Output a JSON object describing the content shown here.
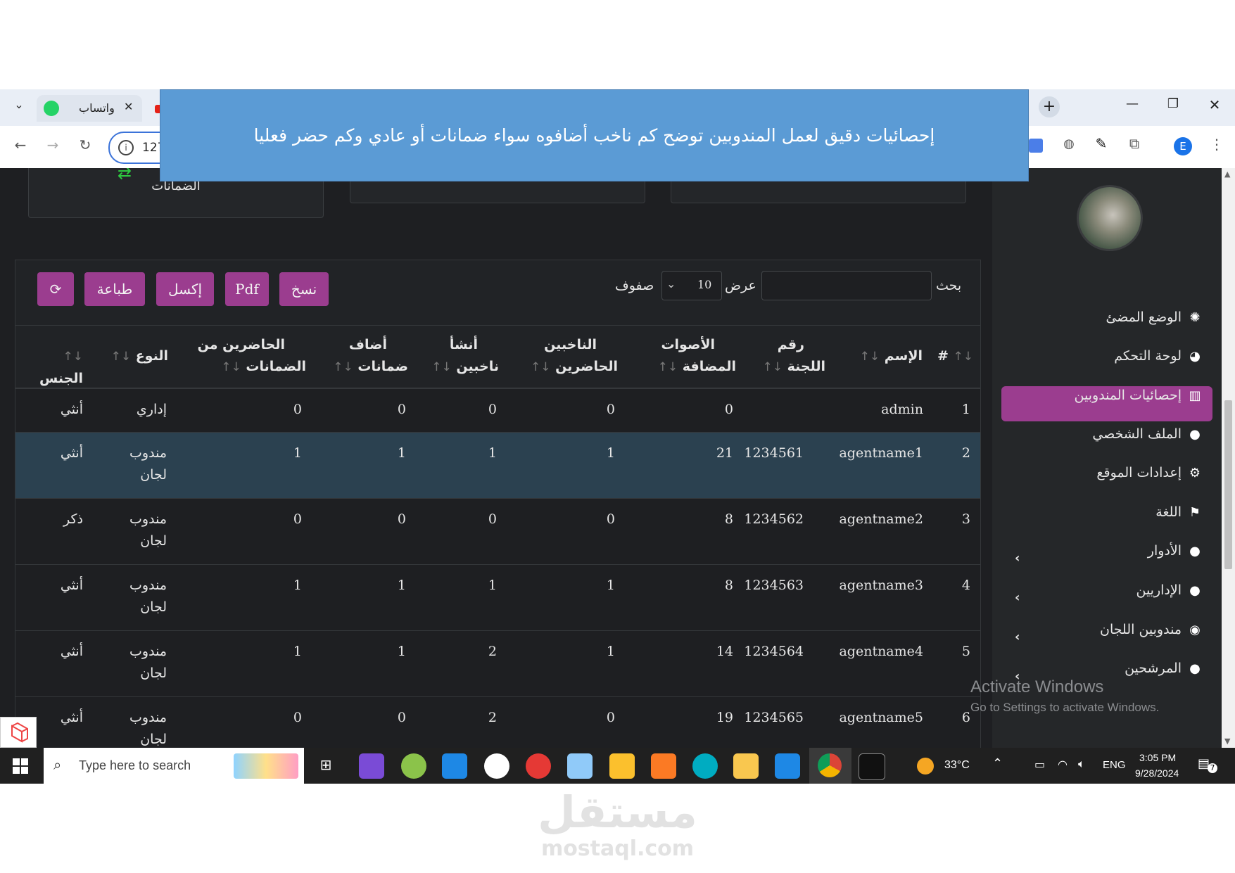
{
  "banner": {
    "text": "إحصائيات دقيق لعمل المندوبين توضح كم ناخب أضافوه سواء ضمانات أو عادي وكم حضر فعليا"
  },
  "browser": {
    "tab_label": "واتساب",
    "address_text": "127",
    "profile_initial": "E"
  },
  "top_cards": {
    "guarantees_label": "الضمانات"
  },
  "sidebar": {
    "items": [
      {
        "label": "الوضع المضئ",
        "icon": "gear-icon"
      },
      {
        "label": "لوحة التحكم",
        "icon": "dashboard-icon"
      },
      {
        "label": "إحصائيات المندوبين",
        "icon": "chart-icon",
        "active": true
      },
      {
        "label": "الملف الشخصي",
        "icon": "user-icon"
      },
      {
        "label": "إعدادات الموقع",
        "icon": "gears-icon"
      },
      {
        "label": "اللغة",
        "icon": "flag-icon"
      },
      {
        "label": "الأدوار",
        "icon": "user-gear-icon",
        "expandable": true
      },
      {
        "label": "الإداريين",
        "icon": "user-tie-icon",
        "expandable": true
      },
      {
        "label": "مندوبين اللجان",
        "icon": "user-circle-icon",
        "expandable": true
      },
      {
        "label": "المرشحين",
        "icon": "users-icon",
        "expandable": true
      }
    ],
    "activate_windows_title": "Activate Windows",
    "activate_windows_sub": "Go to Settings to activate Windows."
  },
  "controls": {
    "search_label": "بحث",
    "show_label": "عرض",
    "rows_label": "صفوف",
    "page_size": "10",
    "buttons": {
      "copy": "نسخ",
      "pdf": "Pdf",
      "excel": "إكسل",
      "print": "طباعة"
    }
  },
  "table": {
    "headers": {
      "num": "#",
      "name": "الإسم",
      "committee_l1": "رقم",
      "committee_l2": "اللجنة",
      "added_l1": "الأصوات",
      "added_l2": "المضافة",
      "present_l1": "الناخبين",
      "present_l2": "الحاضرين",
      "created_l1": "أنشأ",
      "created_l2": "ناخبين",
      "guar_l1": "أضاف",
      "guar_l2": "ضمانات",
      "guarpres_l1": "الحاضرين من",
      "guarpres_l2": "الضمانات",
      "type": "النوع",
      "gender": "الجنس"
    },
    "rows": [
      {
        "num": "1",
        "name": "admin",
        "committee": "",
        "added": "0",
        "present": "0",
        "created": "0",
        "guar": "0",
        "guarpres": "0",
        "type_l1": "إداري",
        "type_l2": "",
        "gender": "أنثي"
      },
      {
        "num": "2",
        "name": "agentname1",
        "committee": "1234561",
        "added": "21",
        "present": "1",
        "created": "1",
        "guar": "1",
        "guarpres": "1",
        "type_l1": "مندوب",
        "type_l2": "لجان",
        "gender": "أنثي"
      },
      {
        "num": "3",
        "name": "agentname2",
        "committee": "1234562",
        "added": "8",
        "present": "0",
        "created": "0",
        "guar": "0",
        "guarpres": "0",
        "type_l1": "مندوب",
        "type_l2": "لجان",
        "gender": "ذكر"
      },
      {
        "num": "4",
        "name": "agentname3",
        "committee": "1234563",
        "added": "8",
        "present": "1",
        "created": "1",
        "guar": "1",
        "guarpres": "1",
        "type_l1": "مندوب",
        "type_l2": "لجان",
        "gender": "أنثي"
      },
      {
        "num": "5",
        "name": "agentname4",
        "committee": "1234564",
        "added": "14",
        "present": "1",
        "created": "2",
        "guar": "1",
        "guarpres": "1",
        "type_l1": "مندوب",
        "type_l2": "لجان",
        "gender": "أنثي"
      },
      {
        "num": "6",
        "name": "agentname5",
        "committee": "1234565",
        "added": "19",
        "present": "0",
        "created": "2",
        "guar": "0",
        "guarpres": "0",
        "type_l1": "مندوب",
        "type_l2": "لجان",
        "gender": "أنثي"
      }
    ]
  },
  "taskbar": {
    "search_placeholder": "Type here to search",
    "weather": "33°C",
    "language": "ENG",
    "time": "3:05 PM",
    "date": "9/28/2024",
    "notification_count": "7"
  },
  "watermark": {
    "arabic": "مستقل",
    "latin": "mostaql.com"
  },
  "colors": {
    "accent": "#9b3d8f",
    "banner": "#5b9bd5",
    "highlight_row": "#2b4150"
  }
}
